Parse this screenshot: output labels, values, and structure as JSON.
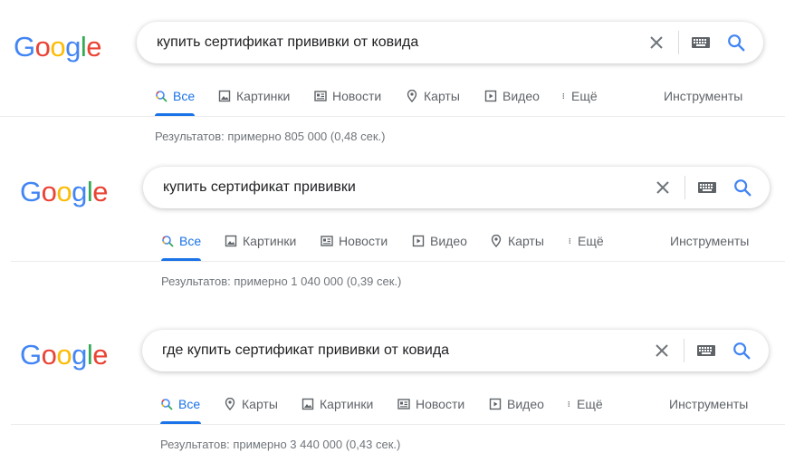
{
  "logo_letters": [
    "G",
    "o",
    "o",
    "g",
    "l",
    "e"
  ],
  "colors": {
    "blue": "#4285f4",
    "red": "#ea4335",
    "yellow": "#fbbc05",
    "green": "#34a853",
    "accent": "#1a73e8",
    "text_secondary": "#5f6368"
  },
  "icons": {
    "clear": "close-icon",
    "keyboard": "keyboard-icon",
    "search": "search-icon"
  },
  "tools_label": "Инструменты",
  "panels": [
    {
      "query": "купить сертификат прививки от ковида",
      "tabs": [
        {
          "label": "Все",
          "icon": "search-icon",
          "active": true
        },
        {
          "label": "Картинки",
          "icon": "image-icon"
        },
        {
          "label": "Новости",
          "icon": "news-icon"
        },
        {
          "label": "Карты",
          "icon": "map-pin-icon"
        },
        {
          "label": "Видео",
          "icon": "video-icon"
        },
        {
          "label": "Ещё",
          "icon": "more-vert-icon"
        }
      ],
      "stats": "Результатов: примерно 805 000 (0,48 сек.)"
    },
    {
      "query": "купить сертификат прививки",
      "tabs": [
        {
          "label": "Все",
          "icon": "search-icon",
          "active": true
        },
        {
          "label": "Картинки",
          "icon": "image-icon"
        },
        {
          "label": "Новости",
          "icon": "news-icon"
        },
        {
          "label": "Видео",
          "icon": "video-icon"
        },
        {
          "label": "Карты",
          "icon": "map-pin-icon"
        },
        {
          "label": "Ещё",
          "icon": "more-vert-icon"
        }
      ],
      "stats": "Результатов: примерно 1 040 000 (0,39 сек.)"
    },
    {
      "query": "где купить сертификат прививки от ковида",
      "tabs": [
        {
          "label": "Все",
          "icon": "search-icon",
          "active": true
        },
        {
          "label": "Карты",
          "icon": "map-pin-icon"
        },
        {
          "label": "Картинки",
          "icon": "image-icon"
        },
        {
          "label": "Новости",
          "icon": "news-icon"
        },
        {
          "label": "Видео",
          "icon": "video-icon"
        },
        {
          "label": "Ещё",
          "icon": "more-vert-icon"
        }
      ],
      "stats": "Результатов: примерно 3 440 000 (0,43 сек.)"
    }
  ]
}
